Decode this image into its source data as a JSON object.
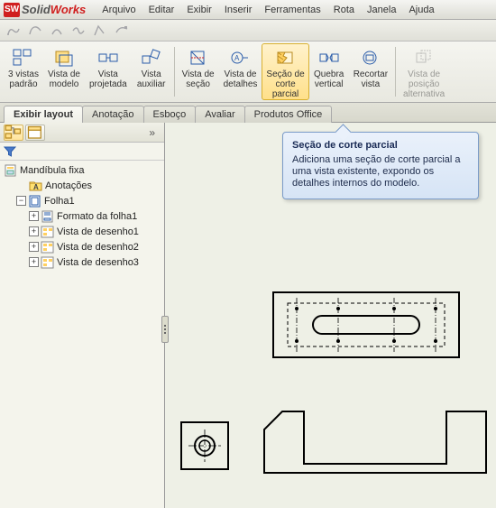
{
  "app": {
    "logo_text": "SW",
    "name_a": "Solid",
    "name_b": "Works"
  },
  "menu": [
    "Arquivo",
    "Editar",
    "Exibir",
    "Inserir",
    "Ferramentas",
    "Rota",
    "Janela",
    "Ajuda"
  ],
  "ribbon": {
    "items": [
      {
        "label": "3 vistas\npadrão"
      },
      {
        "label": "Vista de\nmodelo"
      },
      {
        "label": "Vista\nprojetada"
      },
      {
        "label": "Vista\nauxiliar"
      },
      {
        "label": "Vista de\nseção"
      },
      {
        "label": "Vista de\ndetalhes"
      },
      {
        "label": "Seção de\ncorte\nparcial"
      },
      {
        "label": "Quebra\nvertical"
      },
      {
        "label": "Recortar\nvista"
      },
      {
        "label": "Vista de\nposição\nalternativa"
      }
    ]
  },
  "tabs": [
    "Exibir layout",
    "Anotação",
    "Esboço",
    "Avaliar",
    "Produtos Office"
  ],
  "tree": {
    "root": "Mandíbula fixa",
    "ann": "Anotações",
    "sheet": "Folha1",
    "children": [
      "Formato da folha1",
      "Vista de desenho1",
      "Vista de desenho2",
      "Vista de desenho3"
    ]
  },
  "tooltip": {
    "title": "Seção de corte parcial",
    "body": "Adiciona uma seção de corte parcial a uma vista existente, expondo os detalhes internos do modelo."
  },
  "side_expand": "»"
}
